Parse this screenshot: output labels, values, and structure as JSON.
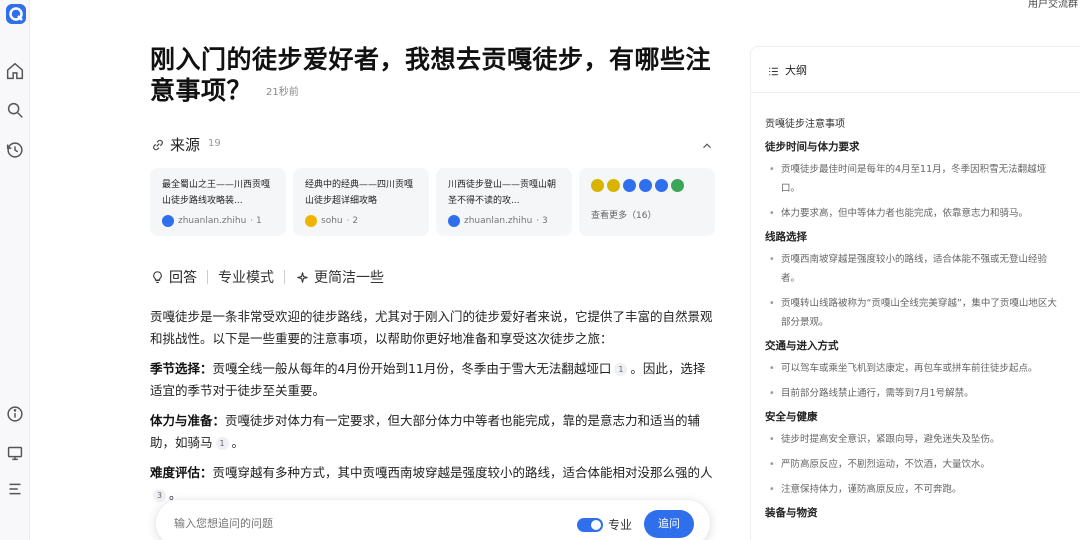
{
  "app": {
    "top_right_text": "用户交流群"
  },
  "sidebar": {
    "icons": [
      "logo-icon",
      "home-icon",
      "search-icon",
      "history-icon",
      "info-icon",
      "monitor-icon",
      "menu-icon"
    ]
  },
  "question": {
    "title": "刚入门的徒步爱好者，我想去贡嘎徒步，有哪些注意事项？",
    "time": "21秒前"
  },
  "sources": {
    "label": "来源",
    "count": "19",
    "cards": [
      {
        "title": "最全蜀山之王——川西贡嘎山徒步路线攻略装...",
        "site": "zhuanlan.zhihu",
        "index": "· 1",
        "fav_color": "#2f6fec"
      },
      {
        "title": "经典中的经典——四川贡嘎山徒步超详细攻略",
        "site": "sohu",
        "index": "· 2",
        "fav_color": "#f0b400"
      },
      {
        "title": "川西徒步登山——贡嘎山朝圣不得不读的攻...",
        "site": "zhuanlan.zhihu",
        "index": "· 3",
        "fav_color": "#2f6fec"
      }
    ],
    "more_label": "查看更多（16）",
    "more_icon_colors": [
      "#d8b400",
      "#d8b400",
      "#2f6fec",
      "#2f6fec",
      "#2f6fec",
      "#3aa657"
    ]
  },
  "tabs": {
    "answer": "回答",
    "pro": "专业模式",
    "concise": "更简洁一些"
  },
  "answer": {
    "intro": "贡嘎徒步是一条非常受欢迎的徒步路线，尤其对于刚入门的徒步爱好者来说，它提供了丰富的自然景观和挑战性。以下是一些重要的注意事项，以帮助你更好地准备和享受这次徒步之旅：",
    "p1_label": "季节选择：",
    "p1_text": "贡嘎全线一般从每年的4月份开始到11月份，冬季由于雪大无法翻越垭口",
    "p1_cite": "1",
    "p1_tail": "。因此，选择适宜的季节对于徒步至关重要。",
    "p2_label": "体力与准备：",
    "p2_text": "贡嘎徒步对体力有一定要求，但大部分体力中等者也能完成，靠的是意志力和适当的辅助，如骑马",
    "p2_cite": "1",
    "p2_tail": "。",
    "p3_label": "难度评估：",
    "p3_text": "贡嘎穿越有多种方式，其中贡嘎西南坡穿越是强度较小的路线，适合体能相对没那么强的人",
    "p3_cite": "3",
    "p3_tail": "。"
  },
  "ask": {
    "placeholder": "输入您想追问的问题",
    "toggle_label": "专业",
    "toggle_on": true,
    "send_label": "追问"
  },
  "outline": {
    "label": "大纲",
    "title": "贡嘎徒步注意事项",
    "sections": [
      {
        "heading": "徒步时间与体力要求",
        "items": [
          "贡嘎徒步最佳时间是每年的4月至11月，冬季因积雪无法翻越垭口。",
          "体力要求高，但中等体力者也能完成，依靠意志力和骑马。"
        ]
      },
      {
        "heading": "线路选择",
        "items": [
          "贡嘎西南坡穿越是强度较小的路线，适合体能不强或无登山经验者。",
          "贡嘎转山线路被称为“贡嘎山全线完美穿越”，集中了贡嘎山地区大部分景观。"
        ]
      },
      {
        "heading": "交通与进入方式",
        "items": [
          "可以驾车或乘坐飞机到达康定，再包车或拼车前往徒步起点。",
          "目前部分路线禁止通行，需等到7月1号解禁。"
        ]
      },
      {
        "heading": "安全与健康",
        "items": [
          "徒步时提高安全意识，紧跟向导，避免迷失及坠伤。",
          "严防高原反应，不剧烈运动，不饮酒，大量饮水。",
          "注意保持体力，谨防高原反应，不可奔跑。"
        ]
      },
      {
        "heading": "装备与物资",
        "items": []
      }
    ]
  }
}
